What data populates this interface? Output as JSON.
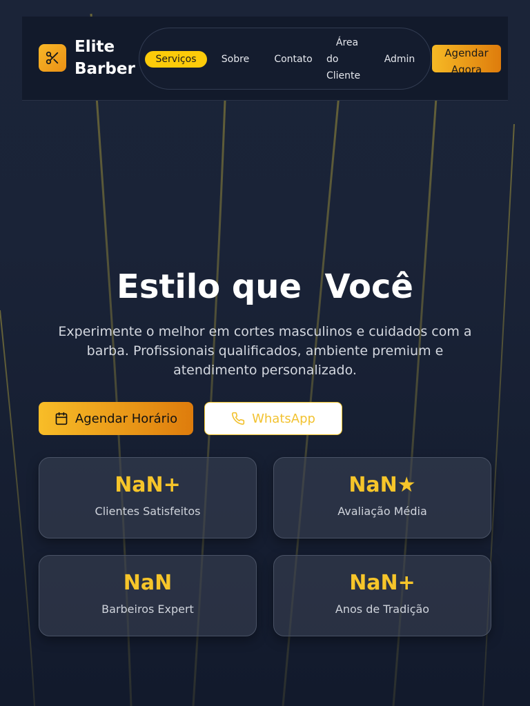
{
  "header": {
    "brand": "Elite Barber",
    "brand_line1": "Elite",
    "brand_line2": "Barber",
    "logo_icon": "scissors-icon",
    "nav": {
      "items": [
        "Serviços",
        "Sobre",
        "Contato",
        "Área do Cliente",
        "Admin"
      ],
      "servicos": "Serviços",
      "sobre": "Sobre",
      "contato": "Contato",
      "area_l1": "Área",
      "area_l2": "do",
      "area_l3": "Cliente",
      "admin": "Admin"
    },
    "cta_line1": "Agendar",
    "cta_line2": "Agora"
  },
  "hero": {
    "title": "Estilo que  Você",
    "subtitle": "Experimente o melhor em cortes masculinos e cuidados com a barba. Profissionais qualificados, ambiente premium e atendimento personalizado.",
    "primary_button": "Agendar Horário",
    "primary_icon": "calendar-icon",
    "secondary_button": "WhatsApp",
    "secondary_icon": "phone-icon"
  },
  "stats": [
    {
      "value": "NaN+",
      "label": "Clientes Satisfeitos"
    },
    {
      "value": "NaN★",
      "label": "Avaliação Média"
    },
    {
      "value": "NaN",
      "label": "Barbeiros Expert"
    },
    {
      "value": "NaN+",
      "label": "Anos de Tradição"
    }
  ],
  "colors": {
    "accent": "#fccb0a",
    "gold": "#f6c52a",
    "orange": "#de7c0c",
    "background": "#1a2337"
  }
}
